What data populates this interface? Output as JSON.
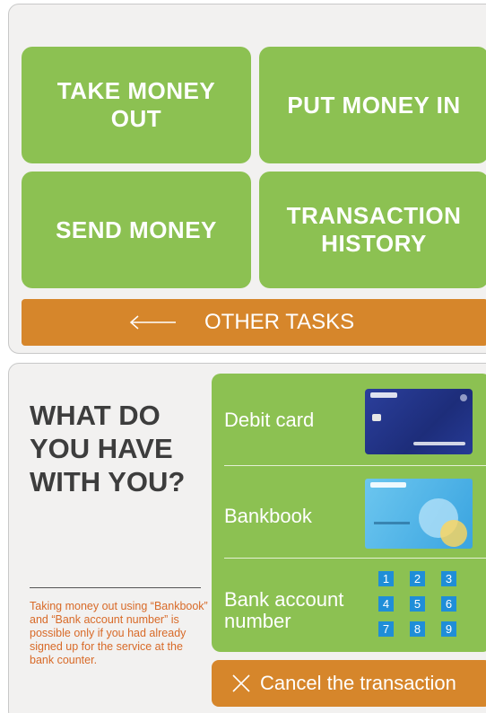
{
  "menu": {
    "take_money_out": "TAKE MONEY OUT",
    "put_money_in": "PUT MONEY IN",
    "send_money": "SEND MONEY",
    "transaction_history": "TRANSACTION HISTORY",
    "other_tasks": "OTHER TASKS"
  },
  "question": {
    "title": "WHAT DO YOU HAVE WITH YOU?",
    "note": "Taking money out using “Bankbook” and “Bank account number” is possible only if you had already signed up for the service at the bank counter."
  },
  "options": {
    "debit_card": "Debit card",
    "bankbook": "Bankbook",
    "bank_account_number": "Bank account number",
    "keypad": [
      "1",
      "2",
      "3",
      "4",
      "5",
      "6",
      "7",
      "8",
      "9"
    ]
  },
  "cancel": {
    "label": "Cancel the transaction"
  },
  "colors": {
    "green": "#8cc152",
    "orange": "#d6862b",
    "key_blue": "#1f8ed8",
    "note_text": "#d86a28"
  },
  "icons": {
    "other_tasks": "arrow-left-icon",
    "cancel": "close-icon"
  }
}
